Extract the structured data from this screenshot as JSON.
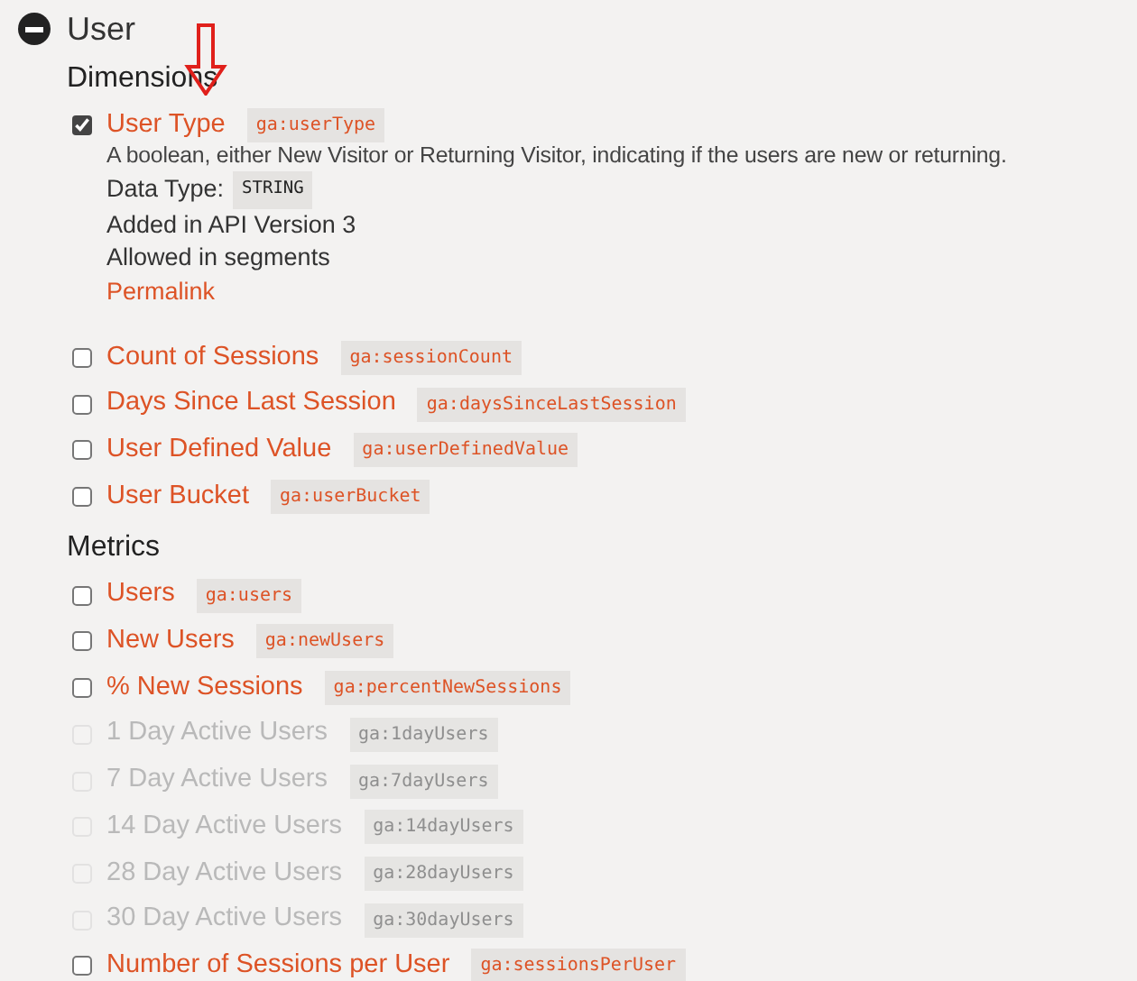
{
  "section": {
    "title": "User",
    "expanded": true
  },
  "groups": [
    {
      "title": "Dimensions",
      "items": [
        {
          "name": "User Type",
          "code": "ga:userType",
          "checked": true,
          "disabled": false,
          "details": {
            "description": "A boolean, either New Visitor or Returning Visitor, indicating if the users are new or returning.",
            "data_type_label": "Data Type:",
            "data_type": "STRING",
            "notes": [
              "Added in API Version 3",
              "Allowed in segments"
            ],
            "link": "Permalink"
          }
        },
        {
          "name": "Count of Sessions",
          "code": "ga:sessionCount",
          "checked": false,
          "disabled": false
        },
        {
          "name": "Days Since Last Session",
          "code": "ga:daysSinceLastSession",
          "checked": false,
          "disabled": false
        },
        {
          "name": "User Defined Value",
          "code": "ga:userDefinedValue",
          "checked": false,
          "disabled": false
        },
        {
          "name": "User Bucket",
          "code": "ga:userBucket",
          "checked": false,
          "disabled": false
        }
      ]
    },
    {
      "title": "Metrics",
      "items": [
        {
          "name": "Users",
          "code": "ga:users",
          "checked": false,
          "disabled": false
        },
        {
          "name": "New Users",
          "code": "ga:newUsers",
          "checked": false,
          "disabled": false
        },
        {
          "name": "% New Sessions",
          "code": "ga:percentNewSessions",
          "checked": false,
          "disabled": false
        },
        {
          "name": "1 Day Active Users",
          "code": "ga:1dayUsers",
          "checked": false,
          "disabled": true
        },
        {
          "name": "7 Day Active Users",
          "code": "ga:7dayUsers",
          "checked": false,
          "disabled": true
        },
        {
          "name": "14 Day Active Users",
          "code": "ga:14dayUsers",
          "checked": false,
          "disabled": true
        },
        {
          "name": "28 Day Active Users",
          "code": "ga:28dayUsers",
          "checked": false,
          "disabled": true
        },
        {
          "name": "30 Day Active Users",
          "code": "ga:30dayUsers",
          "checked": false,
          "disabled": true
        },
        {
          "name": "Number of Sessions per User",
          "code": "ga:sessionsPerUser",
          "checked": false,
          "disabled": false
        }
      ]
    }
  ]
}
